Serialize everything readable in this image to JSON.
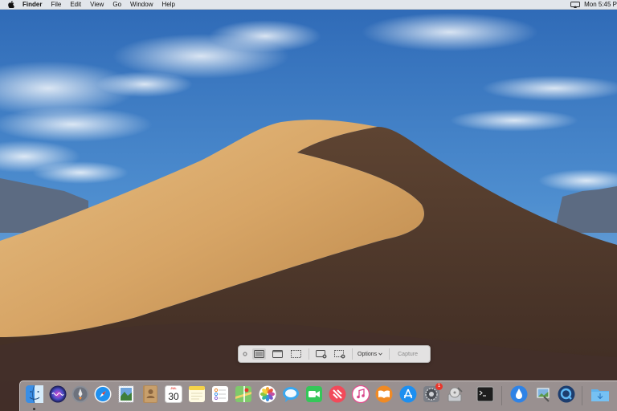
{
  "menubar": {
    "app_name": "Finder",
    "items": [
      "File",
      "Edit",
      "View",
      "Go",
      "Window",
      "Help"
    ],
    "clock": "Mon 5:45 P"
  },
  "capture_toolbar": {
    "tools": [
      {
        "icon": "capture-entire-screen-icon",
        "active": true
      },
      {
        "icon": "capture-selected-window-icon",
        "active": false
      },
      {
        "icon": "capture-selected-portion-icon",
        "active": false
      },
      {
        "icon": "record-entire-screen-icon",
        "active": false
      },
      {
        "icon": "record-selected-portion-icon",
        "active": false
      }
    ],
    "options_label": "Options",
    "capture_label": "Capture"
  },
  "dock": {
    "apps": [
      {
        "icon": "finder-icon"
      },
      {
        "icon": "siri-icon"
      },
      {
        "icon": "launchpad-icon"
      },
      {
        "icon": "safari-icon"
      },
      {
        "icon": "mail-icon"
      },
      {
        "icon": "contacts-icon"
      },
      {
        "icon": "calendar-icon",
        "month": "JUL",
        "day": "30"
      },
      {
        "icon": "notes-icon"
      },
      {
        "icon": "reminders-icon"
      },
      {
        "icon": "maps-icon"
      },
      {
        "icon": "photos-icon"
      },
      {
        "icon": "messages-icon"
      },
      {
        "icon": "facetime-icon"
      },
      {
        "icon": "news-icon"
      },
      {
        "icon": "itunes-icon"
      },
      {
        "icon": "books-icon"
      },
      {
        "icon": "app-store-icon"
      },
      {
        "icon": "system-preferences-icon",
        "badge": "1"
      },
      {
        "icon": "disk-utility-icon"
      },
      {
        "icon": "terminal-icon"
      },
      {
        "icon": "water-drop-icon"
      },
      {
        "icon": "preview-icon"
      },
      {
        "icon": "quicktime-icon"
      },
      {
        "icon": "downloads-folder-icon"
      }
    ],
    "colors": {
      "badge": "#e8372c",
      "accent": "#2f7ff0"
    }
  }
}
